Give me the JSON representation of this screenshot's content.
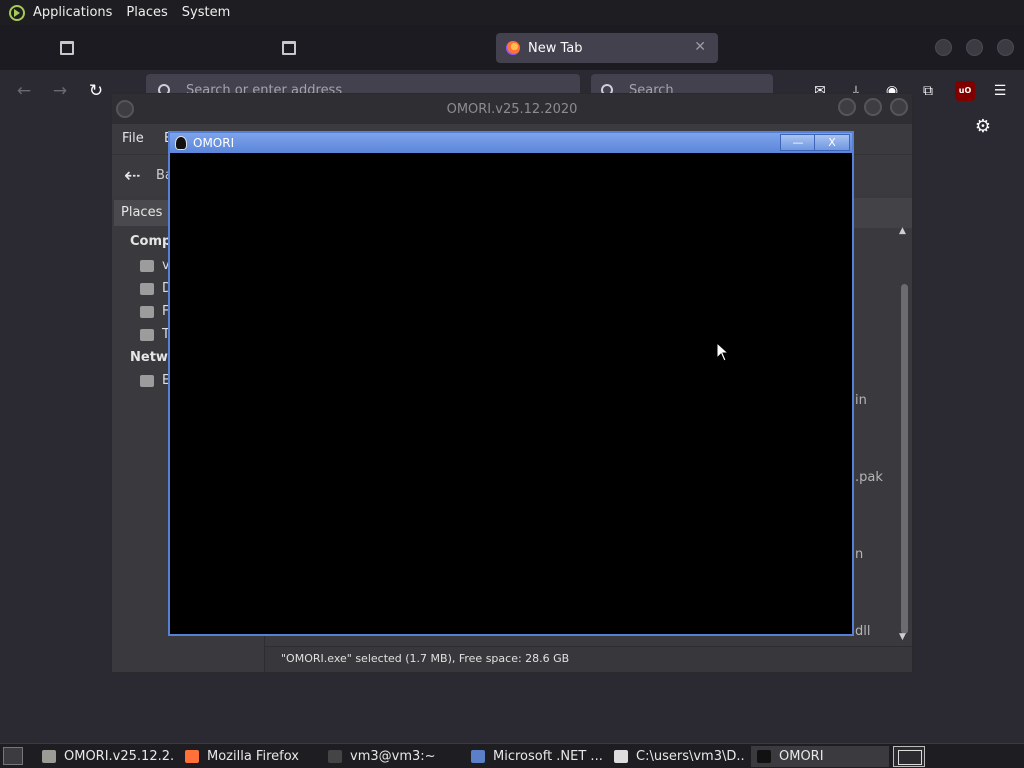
{
  "top_panel": {
    "menus": [
      "Applications",
      "Places",
      "System"
    ]
  },
  "firefox": {
    "active_tab_title": "New Tab",
    "url_placeholder": "Search or enter address",
    "search_placeholder": "Search"
  },
  "file_manager": {
    "title": "OMORI.v25.12.2020",
    "menu": {
      "file": "File",
      "edit_partial": "E"
    },
    "back_label_partial": "Ba",
    "sidebar_header": "Places",
    "categories": [
      "Comp",
      "Netwo"
    ],
    "computer_items": [
      "v",
      "D",
      "F",
      "T"
    ],
    "network_items": [
      "E"
    ],
    "file_fragments": [
      "in",
      ".pak",
      "n",
      "dll"
    ],
    "status": "\"OMORI.exe\" selected (1.7 MB), Free space: 28.6 GB"
  },
  "game_window": {
    "title": "OMORI",
    "minimize_label": "—",
    "close_label": "X"
  },
  "taskbar": {
    "items": [
      {
        "label": "OMORI.v25.12.2...",
        "icon": "folder-icon",
        "color": "#9c9c96"
      },
      {
        "label": "Mozilla Firefox",
        "icon": "firefox-icon",
        "color": "#ff7139"
      },
      {
        "label": "vm3@vm3:~",
        "icon": "terminal-icon",
        "color": "#444444"
      },
      {
        "label": "Microsoft .NET ...",
        "icon": "installer-icon",
        "color": "#5b7fc9"
      },
      {
        "label": "C:\\users\\vm3\\D...",
        "icon": "7zip-icon",
        "color": "#dddddd"
      },
      {
        "label": "OMORI",
        "icon": "omori-icon",
        "color": "#111111"
      }
    ]
  }
}
